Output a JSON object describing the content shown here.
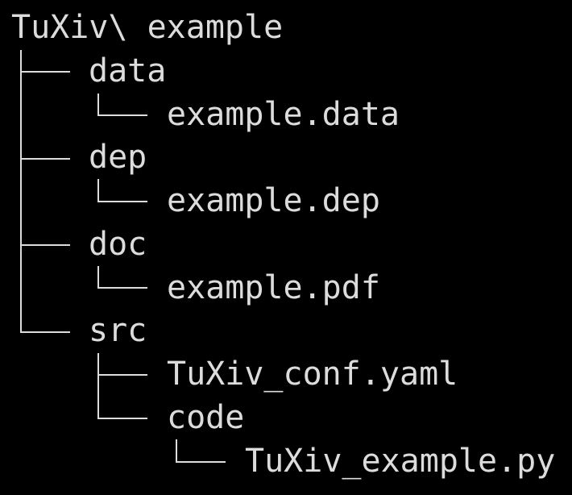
{
  "tree": {
    "root": "TuXiv\\ example",
    "data_dir": "data",
    "data_file": "example.data",
    "dep_dir": "dep",
    "dep_file": "example.dep",
    "doc_dir": "doc",
    "doc_file": "example.pdf",
    "src_dir": "src",
    "conf_file": "TuXiv_conf.yaml",
    "code_dir": "code",
    "code_file": "TuXiv_example.py"
  },
  "colors": {
    "background": "#000000",
    "text": "#dcdcdc"
  }
}
